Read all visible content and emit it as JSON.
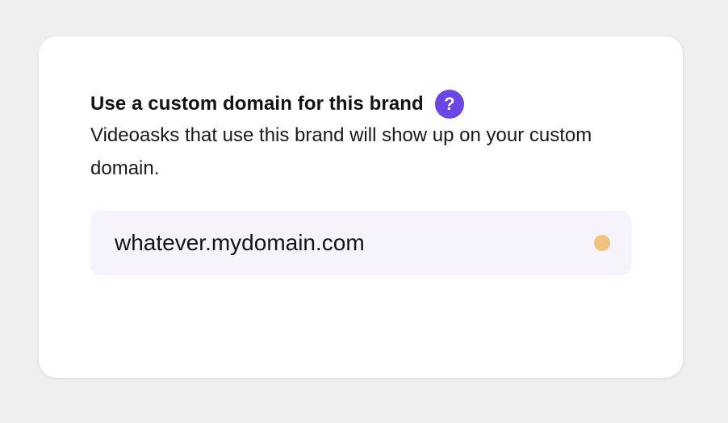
{
  "section": {
    "title": "Use a custom domain for this brand",
    "help_icon": "question-mark-icon",
    "help_glyph": "?",
    "description": "Videoasks that use this brand will show up on your custom domain."
  },
  "domain_input": {
    "value": "whatever.mydomain.com",
    "status_icon": "status-dot-icon",
    "status_color": "#f0c27b"
  },
  "colors": {
    "accent": "#6b46e5",
    "field_background": "#f6f3fd",
    "page_background": "#efefef"
  }
}
